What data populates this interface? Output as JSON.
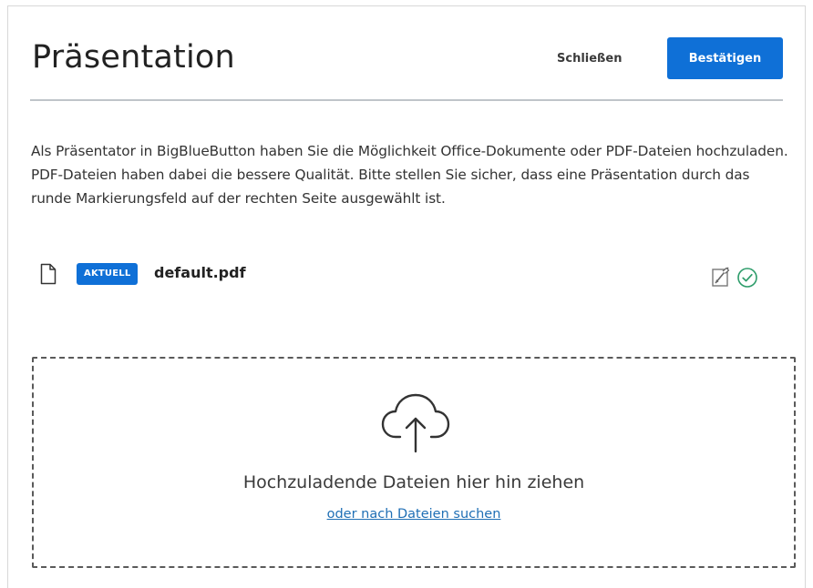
{
  "modal": {
    "title": "Präsentation",
    "close_label": "Schließen",
    "confirm_label": "Bestätigen",
    "description": "Als Präsentator in BigBlueButton haben Sie die Möglichkeit Office-Dokumente oder PDF-Dateien hochzuladen. PDF-Dateien haben dabei die bessere Qualität. Bitte stellen Sie sicher, dass eine Präsentation durch das runde Markierungsfeld auf der rechten Seite ausgewählt ist."
  },
  "files": [
    {
      "badge": "AKTUELL",
      "name": "default.pdf",
      "icons": [
        "file-icon",
        "download-disabled-icon",
        "check-circle-icon"
      ]
    }
  ],
  "dropzone": {
    "icon": "cloud-upload-icon",
    "text": "Hochzuladende Dateien hier hin ziehen",
    "browse_label": "oder nach Dateien suchen"
  },
  "colors": {
    "accent": "#0f70d7",
    "link": "#1f6fb5",
    "divider": "#bfc4c9",
    "check": "#2d9c6a"
  }
}
